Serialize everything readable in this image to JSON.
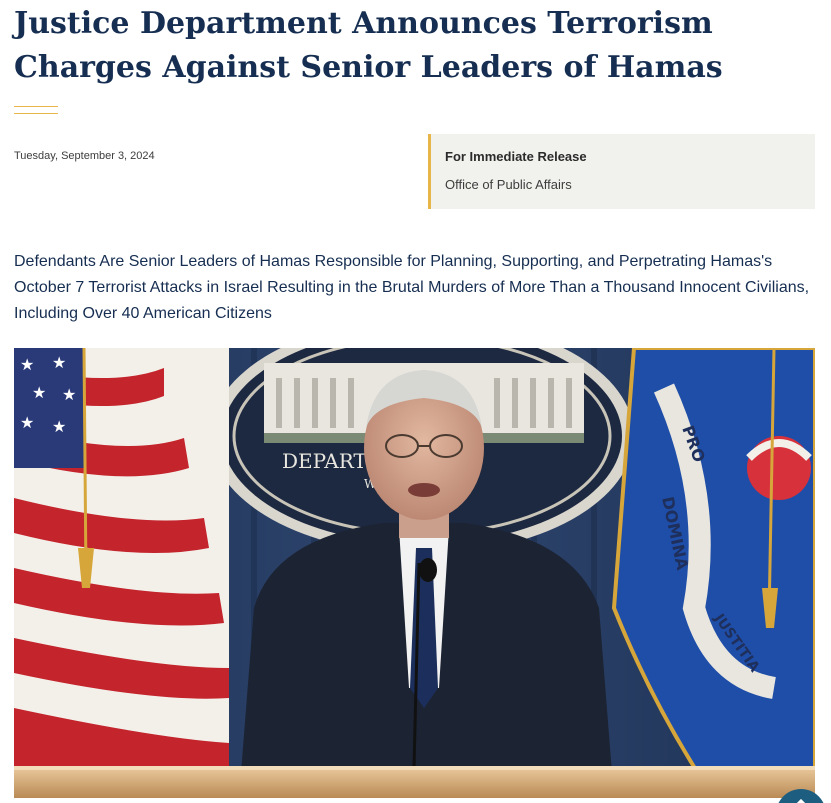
{
  "article": {
    "title": "Justice Department Announces Terrorism Charges Against Senior Leaders of Hamas",
    "date": "Tuesday, September 3, 2024",
    "release": {
      "label": "For Immediate Release",
      "office": "Office of Public Affairs"
    },
    "subtitle": "Defendants Are Senior Leaders of Hamas Responsible for Planning, Supporting, and Perpetrating Hamas's October 7 Terrorist Attacks in Israel Resulting in the Brutal Murders of More Than a Thousand Innocent Civilians, Including Over 40 American Citizens"
  },
  "photo": {
    "seal_text": "DEPARTM   STICE",
    "seal_subtext": "WA",
    "flag_text_1": "PRO",
    "flag_text_2": "DOMINA",
    "flag_text_3": "JUSTITIA"
  },
  "colors": {
    "title": "#162e51",
    "accent": "#e8b548",
    "release_bg": "#f1f1ed",
    "scroll_button": "#1d5d80"
  },
  "icons": {
    "scroll_top": "chevron-up-icon"
  }
}
